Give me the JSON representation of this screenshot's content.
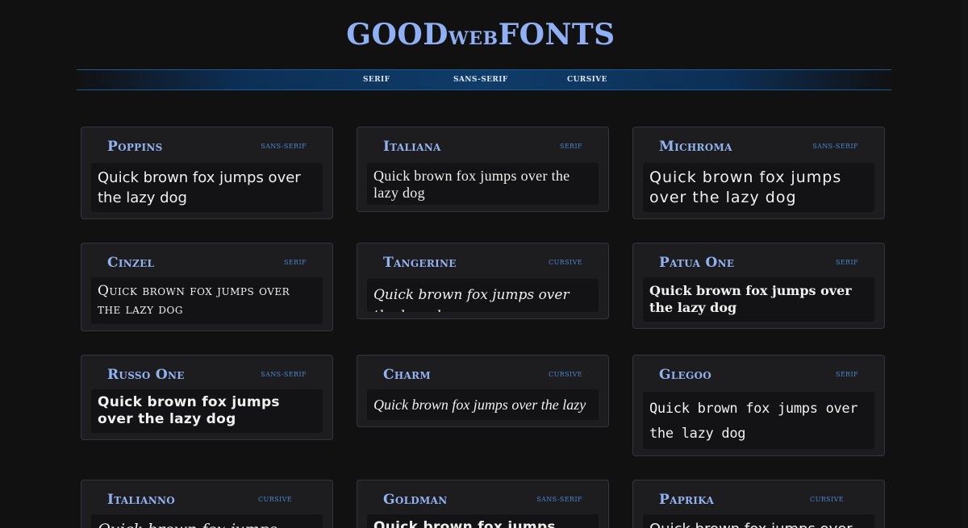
{
  "logo": {
    "part1": "GOOD",
    "part2": "WEB",
    "part3": "FONTS"
  },
  "nav": {
    "items": [
      "SERIF",
      "SANS-SERIF",
      "CURSIVE"
    ]
  },
  "cards": [
    {
      "name": "Poppins",
      "category": "SANS-SERIF",
      "preview": "Quick brown fox jumps over the lazy dog"
    },
    {
      "name": "Italiana",
      "category": "SERIF",
      "preview": "Quick brown fox jumps over the lazy dog"
    },
    {
      "name": "Michroma",
      "category": "SANS-SERIF",
      "preview": "Quick brown fox jumps over the lazy dog"
    },
    {
      "name": "Cinzel",
      "category": "SERIF",
      "preview": "Quick brown fox jumps over the lazy dog"
    },
    {
      "name": "Tangerine",
      "category": "CURSIVE",
      "preview": "Quick brown fox jumps over the lazy dog"
    },
    {
      "name": "Patua One",
      "category": "SERIF",
      "preview": "Quick brown fox jumps over the lazy dog"
    },
    {
      "name": "Russo One",
      "category": "SANS-SERIF",
      "preview": "Quick brown fox jumps over the lazy dog"
    },
    {
      "name": "Charm",
      "category": "CURSIVE",
      "preview": "Quick brown fox jumps over the lazy dog"
    },
    {
      "name": "Glegoo",
      "category": "SERIF",
      "preview": "Quick brown fox jumps over the lazy dog"
    },
    {
      "name": "Italianno",
      "category": "CURSIVE",
      "preview": "Quick brown fox jumps over the lazy dog"
    },
    {
      "name": "Goldman",
      "category": "SANS-SERIF",
      "preview": "Quick brown fox jumps over the lazy dog"
    },
    {
      "name": "Paprika",
      "category": "CURSIVE",
      "preview": "Quick brown fox jumps over the lazy dog"
    }
  ]
}
